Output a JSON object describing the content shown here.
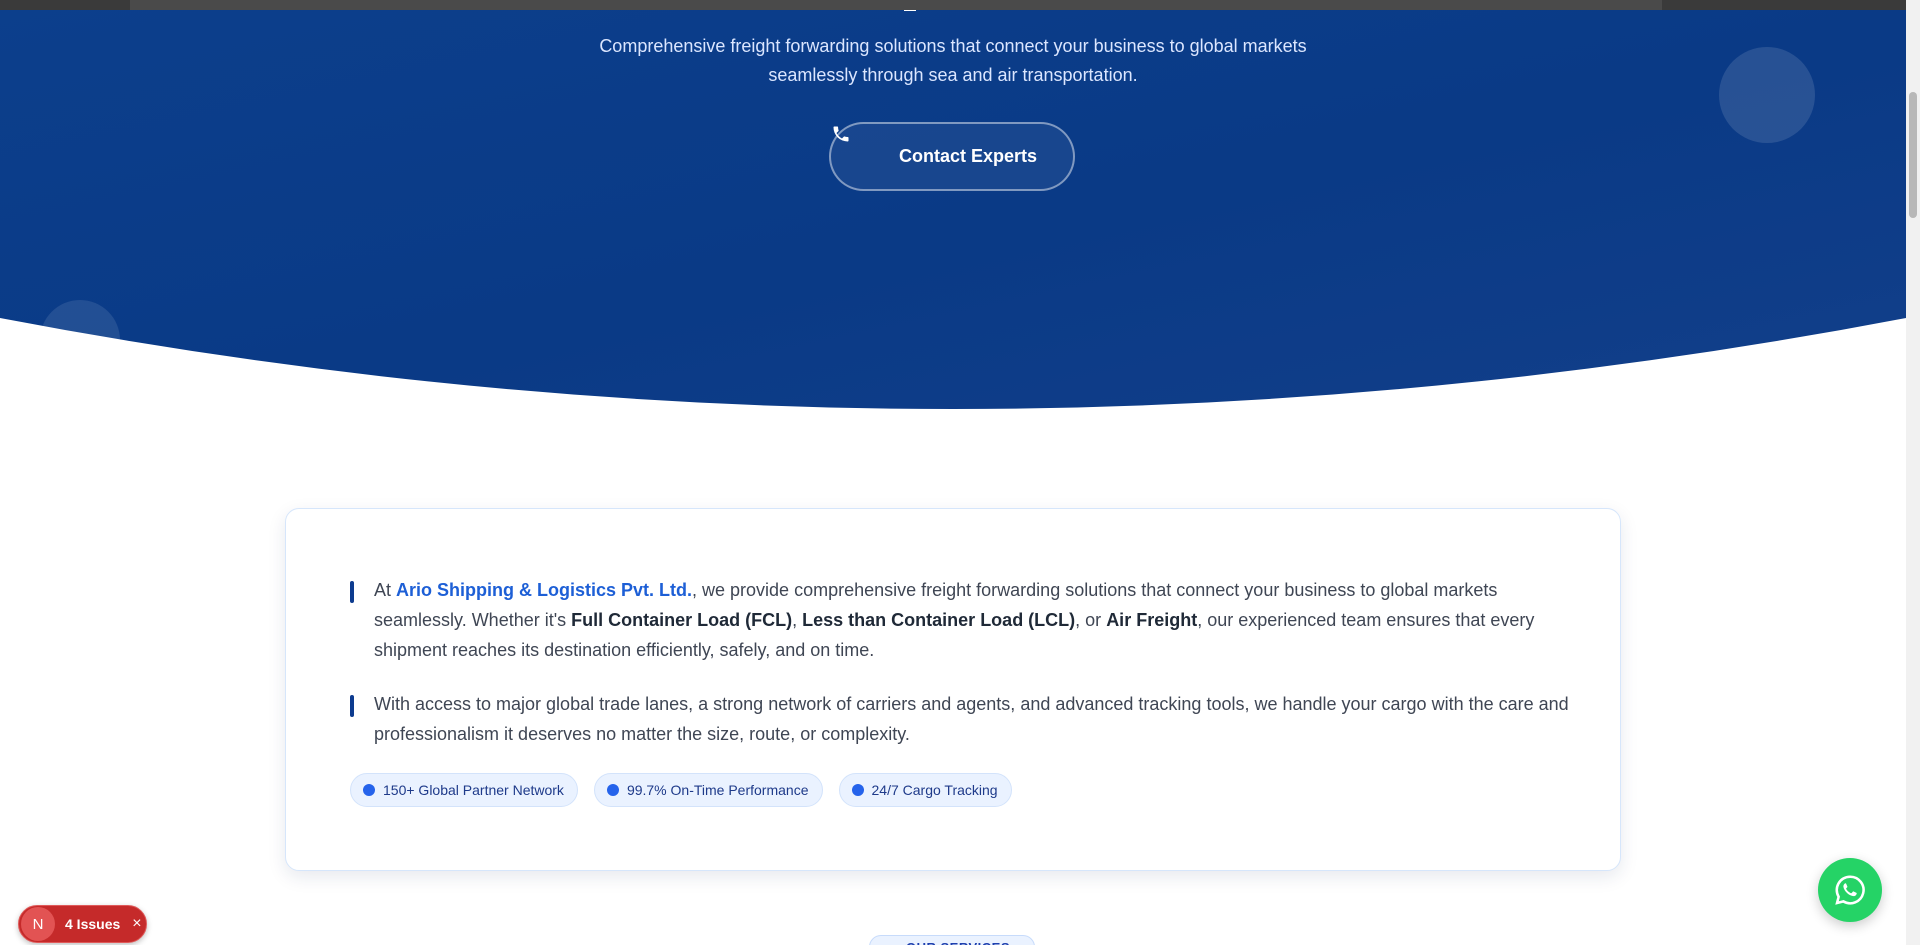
{
  "hero": {
    "subtitle": "Comprehensive freight forwarding solutions that connect your business to global markets seamlessly through sea and air transportation.",
    "contact_button": "Contact Experts",
    "contact_icon": "phone-icon"
  },
  "about": {
    "p1": {
      "t1": "At ",
      "brand": "Ario Shipping & Logistics Pvt. Ltd.",
      "t2": ", we provide comprehensive freight forwarding solutions that connect your business to global markets seamlessly. Whether it's ",
      "b1": "Full Container Load (FCL)",
      "t3": ", ",
      "b2": "Less than Container Load (LCL)",
      "t4": ", or ",
      "b3": "Air Freight",
      "t5": ", our experienced team ensures that every shipment reaches its destination efficiently, safely, and on time."
    },
    "p2": "With access to major global trade lanes, a strong network of carriers and agents, and advanced tracking tools, we handle your cargo with the care and professionalism it deserves no matter the size, route, or complexity.",
    "chips": [
      "150+ Global Partner Network",
      "99.7% On-Time Performance",
      "24/7 Cargo Tracking"
    ]
  },
  "services_badge": "OUR SERVICES",
  "whatsapp_icon": "whatsapp-icon",
  "dev_overlay": {
    "badge": "N",
    "issues": "4 Issues",
    "close": "×"
  },
  "colors": {
    "hero_dark": "#08367f",
    "hero_light": "#1a4fa0",
    "accent": "#1d5fd6",
    "whatsapp": "#25d366",
    "issues_red": "#c52a2a"
  }
}
